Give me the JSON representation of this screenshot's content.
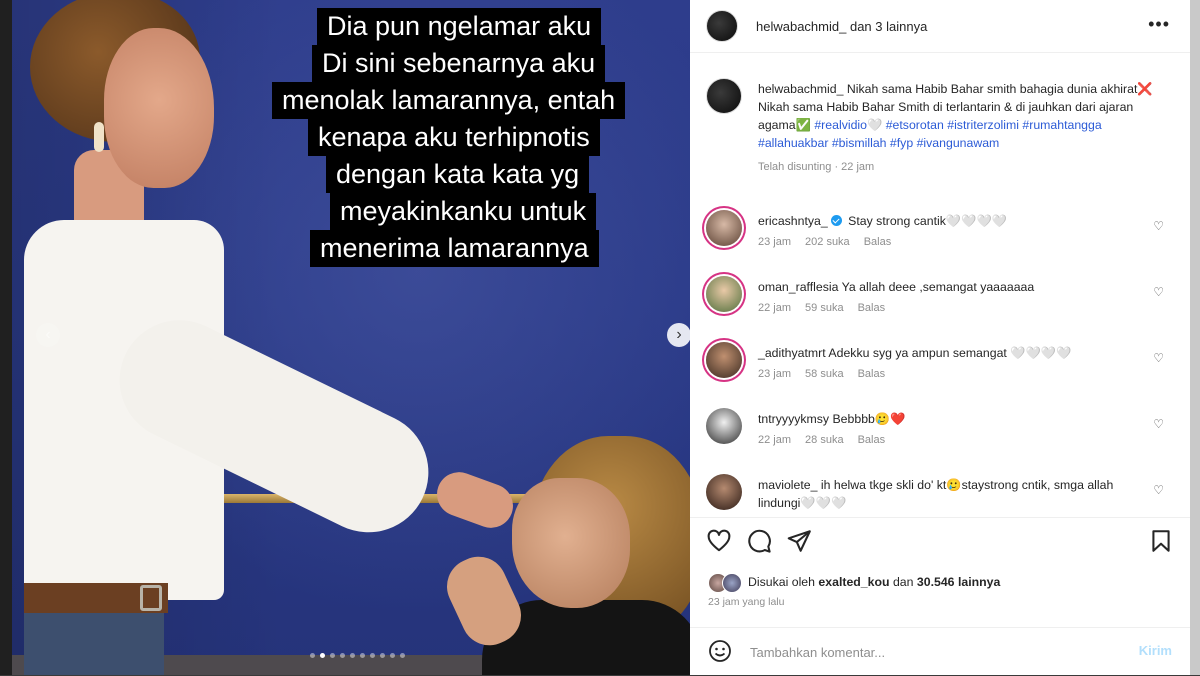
{
  "photo": {
    "caption_lines": [
      "Dia pun ngelamar aku",
      "Di sini sebenarnya aku",
      "menolak lamarannya, entah",
      "kenapa aku terhipnotis",
      "dengan kata kata yg",
      "meyakinkanku untuk",
      "menerima lamarannya"
    ],
    "carousel": {
      "total": 10,
      "active": 2
    },
    "nav_next_icon": "chevron-right-icon",
    "nav_prev_icon": "chevron-left-icon"
  },
  "header": {
    "username": "helwabachmid_",
    "collab_text": "dan 3 lainnya",
    "more_icon": "more-horizontal-icon"
  },
  "caption": {
    "username": "helwabachmid_",
    "text_1": "Nikah sama Habib Bahar smith bahagia dunia akhirat❌",
    "text_2": "Nikah sama Habib Bahar Smith di terlantarin & di jauhkan dari ajaran agama✅",
    "hashtags": "#realvidio🤍 #etsorotan #istriterzolimi #rumahtangga #allahuakbar #bismillah #fyp #ivangunawam",
    "meta": "Telah disunting · 22 jam"
  },
  "comments": [
    {
      "username": "ericashntya_",
      "verified": true,
      "text": "Stay strong cantik🤍🤍🤍🤍",
      "time": "23 jam",
      "likes": "202 suka",
      "reply": "Balas"
    },
    {
      "username": "oman_rafflesia",
      "verified": false,
      "text": "Ya allah deee ,semangat yaaaaaaa",
      "time": "22 jam",
      "likes": "59 suka",
      "reply": "Balas"
    },
    {
      "username": "_adithyatmrt",
      "verified": false,
      "text": "Adekku syg ya ampun semangat 🤍🤍🤍🤍",
      "time": "23 jam",
      "likes": "58 suka",
      "reply": "Balas"
    },
    {
      "username": "tntryyyykmsy",
      "verified": false,
      "text": "Bebbbb🥲❤️",
      "time": "22 jam",
      "likes": "28 suka",
      "reply": "Balas"
    },
    {
      "username": "maviolete_",
      "verified": false,
      "text": "ih helwa tkge skli do' kt🥲staystrong cntik, smga allah lindungi🤍🤍🤍",
      "time": "",
      "likes": "",
      "reply": ""
    }
  ],
  "actions": {
    "like_icon": "heart-icon",
    "comment_icon": "comment-icon",
    "share_icon": "send-icon",
    "save_icon": "bookmark-icon"
  },
  "likes": {
    "prefix": "Disukai oleh",
    "user": "exalted_kou",
    "middle": "dan",
    "count": "30.546",
    "suffix": "lainnya"
  },
  "time_ago": "23 jam yang lalu",
  "add_comment": {
    "placeholder": "Tambahkan komentar...",
    "post_label": "Kirim",
    "emoji_icon": "smiley-icon"
  },
  "colors": {
    "link": "#2c5bd6",
    "verified": "#1d9bf0",
    "post_button_disabled": "#b2dffc"
  }
}
